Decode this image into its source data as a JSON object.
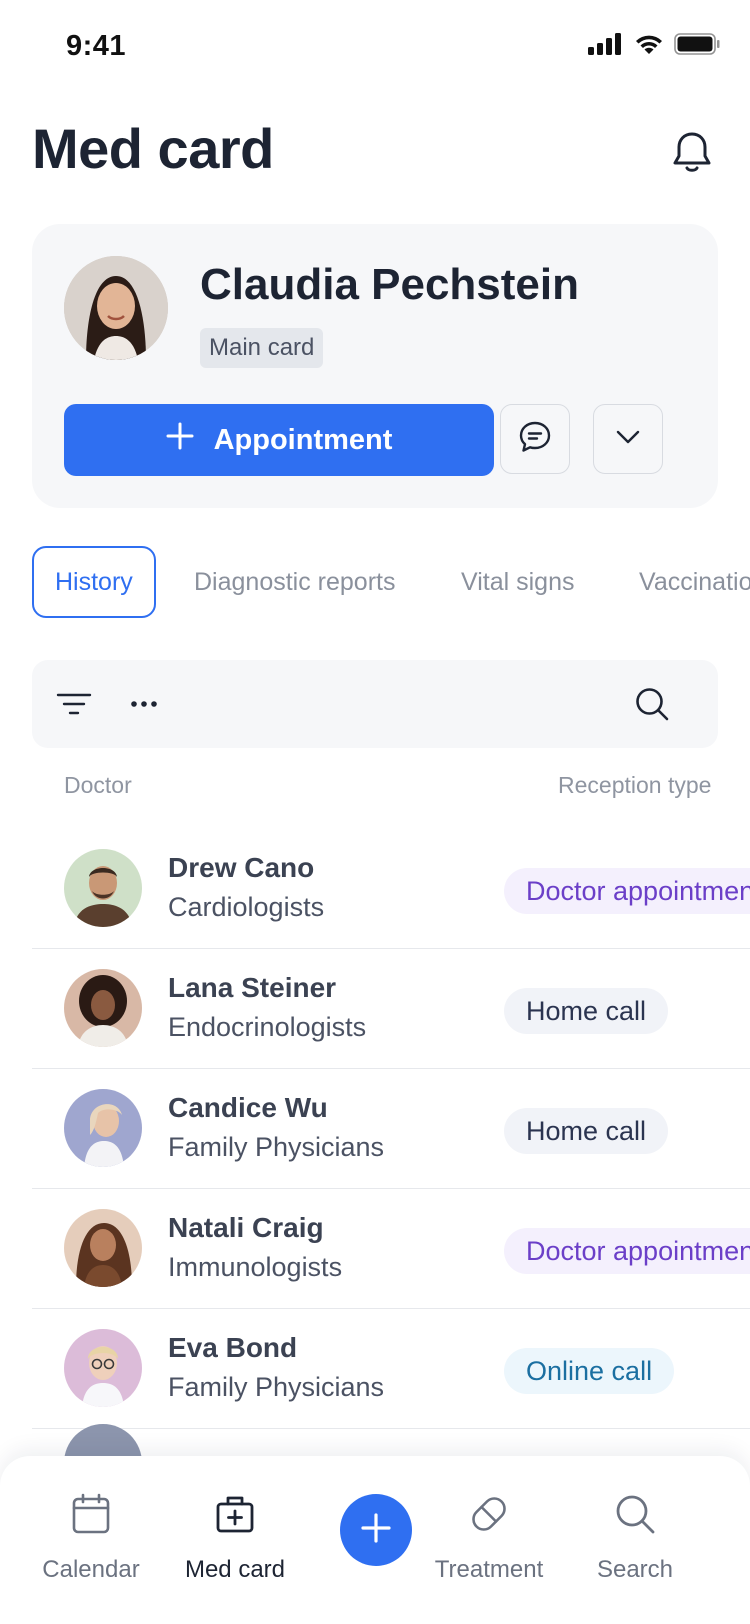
{
  "status": {
    "time": "9:41"
  },
  "header": {
    "title": "Med card"
  },
  "profile": {
    "name": "Claudia Pechstein",
    "badge": "Main card",
    "appointment_label": "Appointment"
  },
  "tabs": [
    "History",
    "Diagnostic reports",
    "Vital signs",
    "Vaccinations"
  ],
  "table": {
    "col_doctor": "Doctor",
    "col_reception": "Reception type",
    "rows": [
      {
        "name": "Drew Cano",
        "spec": "Cardiologists",
        "type": "Doctor appointment"
      },
      {
        "name": "Lana Steiner",
        "spec": "Endocrinologists",
        "type": "Home call"
      },
      {
        "name": "Candice Wu",
        "spec": "Family Physicians",
        "type": "Home call"
      },
      {
        "name": "Natali Craig",
        "spec": "Immunologists",
        "type": "Doctor appointment"
      },
      {
        "name": "Eva Bond",
        "spec": "Family Physicians",
        "type": "Online call"
      }
    ]
  },
  "nav": {
    "calendar": "Calendar",
    "medcard": "Med card",
    "treatment": "Treatment",
    "search": "Search"
  },
  "colors": {
    "primary": "#2f6ff1",
    "doctor_appointment_text": "#6b3fc8",
    "doctor_appointment_bg": "#f4f0fd",
    "home_call_text": "#2b3450",
    "home_call_bg": "#f1f3f8",
    "online_call_text": "#1b6fa1",
    "online_call_bg": "#ecf6fc"
  }
}
